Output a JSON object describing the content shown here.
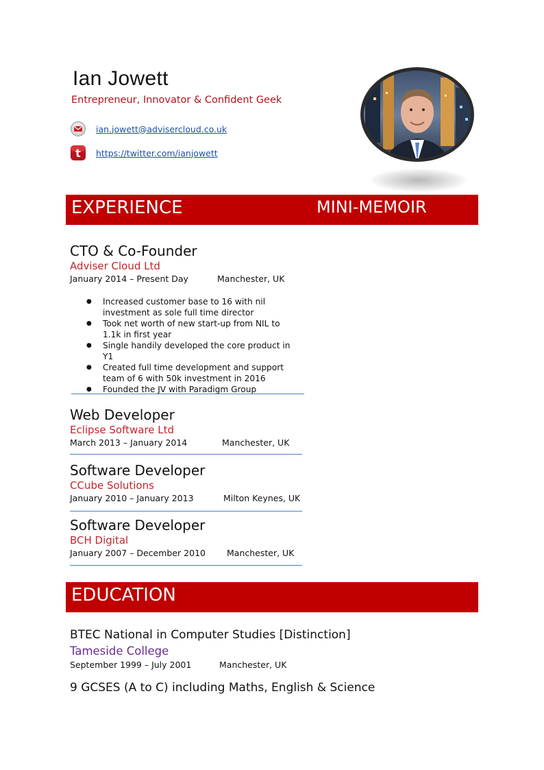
{
  "header": {
    "name": "Ian Jowett",
    "tagline": "Entrepreneur, Innovator & Confident Geek",
    "email": "ian.jowett@advisercloud.co.uk",
    "twitter": "https://twitter.com/ianjowett",
    "icons": {
      "email": "envelope-icon",
      "twitter": "twitter-icon"
    },
    "photo": "profile-photo"
  },
  "colors": {
    "accent": "#c00000",
    "company": "#c0262d",
    "college": "#6a2c91",
    "link": "#1f4fa8",
    "divider": "#4a7fc1"
  },
  "sections": {
    "experience": "EXPERIENCE",
    "mini_memoir": "MINI-MEMOIR",
    "education": "EDUCATION"
  },
  "jobs": [
    {
      "title": "CTO & Co-Founder",
      "company": "Adviser Cloud Ltd",
      "dates": "January 2014 – Present Day",
      "location": "Manchester, UK",
      "bullets": [
        "Increased customer base to 16 with nil investment as sole full time director",
        "Took net worth of new start-up from NIL to 1.1k in first year",
        "Single handily developed the core product in Y1",
        "Created full time development and support team of 6 with 50k investment in 2016",
        "Founded the JV with Paradigm Group"
      ]
    },
    {
      "title": "Web Developer",
      "company": "Eclipse Software Ltd",
      "dates": "March 2013 – January 2014",
      "location": "Manchester, UK"
    },
    {
      "title": "Software Developer",
      "company": "CCube Solutions",
      "dates": "January 2010 – January 2013",
      "location": "Milton Keynes, UK"
    },
    {
      "title": "Software Developer",
      "company": "BCH Digital",
      "dates": "January 2007 – December 2010",
      "location": "Manchester, UK"
    }
  ],
  "education": [
    {
      "degree": "BTEC National in Computer Studies [Distinction]",
      "college": "Tameside College",
      "dates": "September 1999 – July 2001",
      "location": "Manchester, UK"
    },
    {
      "degree": "9 GCSES (A to C) including Maths, English & Science"
    }
  ]
}
